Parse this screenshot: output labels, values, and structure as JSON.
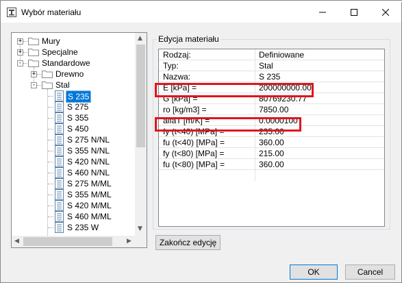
{
  "window": {
    "title": "Wybór materiału",
    "controls": {
      "minimize": "minimize-icon",
      "maximize": "maximize-icon",
      "close": "close-icon"
    }
  },
  "tree": {
    "nodes": [
      {
        "label": "Mury",
        "expander": "+"
      },
      {
        "label": "Specjalne",
        "expander": "+"
      },
      {
        "label": "Standardowe",
        "expander": "-"
      },
      {
        "label": "Drewno",
        "expander": "+"
      },
      {
        "label": "Stal",
        "expander": "-"
      },
      {
        "label": "S 235",
        "selected": true
      },
      {
        "label": "S 275"
      },
      {
        "label": "S 355"
      },
      {
        "label": "S 450"
      },
      {
        "label": "S 275 N/NL"
      },
      {
        "label": "S 355 N/NL"
      },
      {
        "label": "S 420 N/NL"
      },
      {
        "label": "S 460 N/NL"
      },
      {
        "label": "S 275 M/ML"
      },
      {
        "label": "S 355 M/ML"
      },
      {
        "label": "S 420 M/ML"
      },
      {
        "label": "S 460 M/ML"
      },
      {
        "label": "S 235 W"
      }
    ]
  },
  "editor": {
    "group_title": "Edycja materiału",
    "rows": [
      {
        "name": "Rodzaj:",
        "value": "Definiowane"
      },
      {
        "name": "Typ:",
        "value": "Stal"
      },
      {
        "name": "Nazwa:",
        "value": "S 235"
      },
      {
        "name": "E [kPa] =",
        "value": "200000000.00",
        "highlighted": true
      },
      {
        "name": "G [kPa] =",
        "value": "80769230.77"
      },
      {
        "name": "ro [kg/m3] =",
        "value": "7850.00"
      },
      {
        "name": "alfaT [m/K] =",
        "value": "0.0000100",
        "highlighted": true
      },
      {
        "name": "fy (t<40) [MPa] =",
        "value": "235.00"
      },
      {
        "name": "fu (t<40) [MPa] =",
        "value": "360.00"
      },
      {
        "name": "fy (t<80) [MPa] =",
        "value": "215.00"
      },
      {
        "name": "fu (t<80) [MPa] =",
        "value": "360.00"
      }
    ],
    "finish_button": "Zakończ edycję"
  },
  "footer": {
    "ok": "OK",
    "cancel": "Cancel"
  },
  "colors": {
    "selection": "#0078d7",
    "highlight_frame": "#e0141e"
  }
}
